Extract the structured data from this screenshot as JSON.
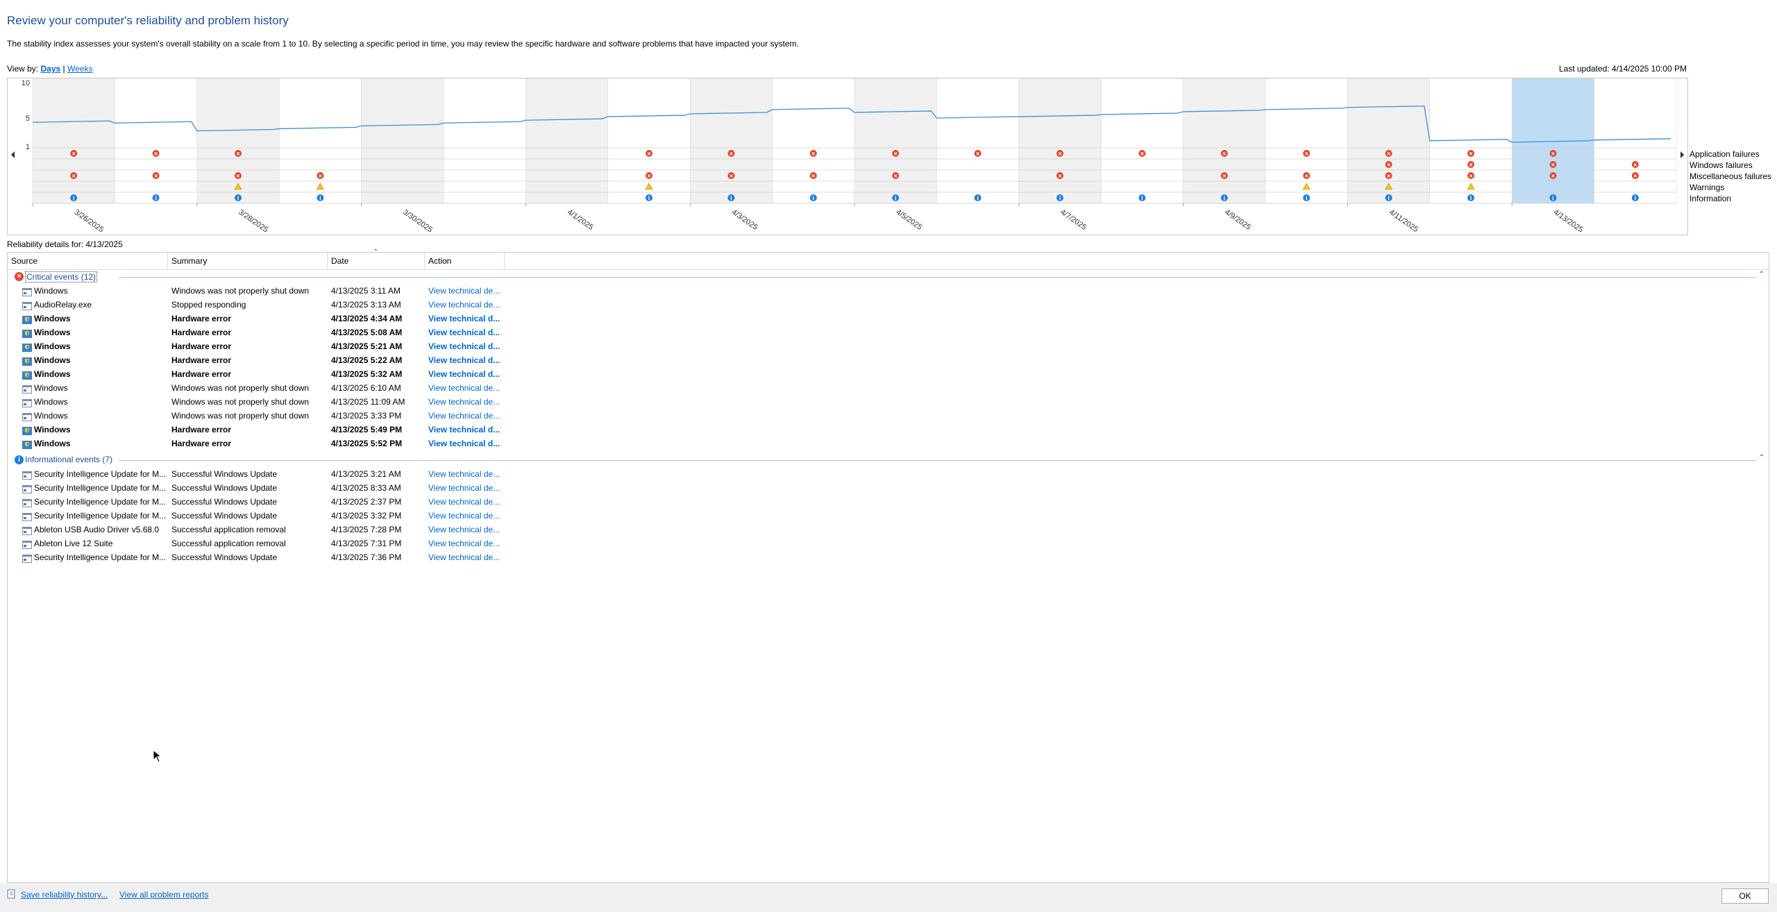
{
  "header": {
    "title": "Review your computer's reliability and problem history",
    "description": "The stability index assesses your system's overall stability on a scale from 1 to 10. By selecting a specific period in time, you may review the specific hardware and software problems that have impacted your system.",
    "view_by_label": "View by:",
    "view_days": "Days",
    "view_sep": "|",
    "view_weeks": "Weeks",
    "last_updated": "Last updated: 4/14/2025 10:00 PM"
  },
  "chart_data": {
    "type": "line",
    "y_ticks": [
      "10",
      "5",
      "1"
    ],
    "ylim": [
      1,
      10
    ],
    "x_labels": [
      "3/26/2025",
      "3/28/2025",
      "3/30/2025",
      "4/1/2025",
      "4/3/2025",
      "4/5/2025",
      "4/7/2025",
      "4/9/2025",
      "4/11/2025",
      "4/13/2025"
    ],
    "selected_day_index": 18,
    "stability_index": [
      3.4,
      3.3,
      2.2,
      2.5,
      2.9,
      3.3,
      3.7,
      4.2,
      4.6,
      5.2,
      4.8,
      4.0,
      4.2,
      4.5,
      4.9,
      5.2,
      5.5,
      0.8,
      0.6,
      0.9
    ],
    "rows": [
      "Application failures",
      "Windows failures",
      "Miscellaneous failures",
      "Warnings",
      "Information"
    ],
    "markers": {
      "Application failures": [
        0,
        1,
        2,
        7,
        8,
        9,
        10,
        11,
        12,
        13,
        14,
        15,
        16,
        17,
        18
      ],
      "Windows failures": [
        16,
        17,
        18,
        19
      ],
      "Miscellaneous failures": [
        0,
        1,
        2,
        3,
        7,
        8,
        9,
        10,
        12,
        14,
        15,
        16,
        17,
        18,
        19
      ],
      "Warnings": [
        2,
        3,
        7,
        15,
        16,
        17
      ],
      "Information": [
        0,
        1,
        2,
        3,
        7,
        8,
        9,
        10,
        11,
        12,
        13,
        14,
        15,
        16,
        17,
        18,
        19
      ]
    }
  },
  "legend": {
    "app_failures": "Application failures",
    "win_failures": "Windows failures",
    "misc_failures": "Miscellaneous failures",
    "warnings": "Warnings",
    "information": "Information"
  },
  "details": {
    "label": "Reliability details for: 4/13/2025",
    "columns": {
      "source": "Source",
      "summary": "Summary",
      "date": "Date",
      "action": "Action"
    },
    "critical_group": "Critical events (12)",
    "info_group": "Informational events (7)",
    "critical_rows": [
      {
        "source": "Windows",
        "summary": "Windows was not properly shut down",
        "date": "4/13/2025 3:11 AM",
        "action": "View technical de...",
        "bold": false
      },
      {
        "source": "AudioRelay.exe",
        "summary": "Stopped responding",
        "date": "4/13/2025 3:13 AM",
        "action": "View technical de...",
        "bold": false
      },
      {
        "source": "Windows",
        "summary": "Hardware error",
        "date": "4/13/2025 4:34 AM",
        "action": "View technical d...",
        "bold": true
      },
      {
        "source": "Windows",
        "summary": "Hardware error",
        "date": "4/13/2025 5:08 AM",
        "action": "View technical d...",
        "bold": true
      },
      {
        "source": "Windows",
        "summary": "Hardware error",
        "date": "4/13/2025 5:21 AM",
        "action": "View technical d...",
        "bold": true
      },
      {
        "source": "Windows",
        "summary": "Hardware error",
        "date": "4/13/2025 5:22 AM",
        "action": "View technical d...",
        "bold": true
      },
      {
        "source": "Windows",
        "summary": "Hardware error",
        "date": "4/13/2025 5:32 AM",
        "action": "View technical d...",
        "bold": true
      },
      {
        "source": "Windows",
        "summary": "Windows was not properly shut down",
        "date": "4/13/2025 6:10 AM",
        "action": "View technical de...",
        "bold": false
      },
      {
        "source": "Windows",
        "summary": "Windows was not properly shut down",
        "date": "4/13/2025 11:09 AM",
        "action": "View technical de...",
        "bold": false
      },
      {
        "source": "Windows",
        "summary": "Windows was not properly shut down",
        "date": "4/13/2025 3:33 PM",
        "action": "View technical de...",
        "bold": false
      },
      {
        "source": "Windows",
        "summary": "Hardware error",
        "date": "4/13/2025 5:49 PM",
        "action": "View technical d...",
        "bold": true
      },
      {
        "source": "Windows",
        "summary": "Hardware error",
        "date": "4/13/2025 5:52 PM",
        "action": "View technical d...",
        "bold": true
      }
    ],
    "info_rows": [
      {
        "source": "Security Intelligence Update for M...",
        "summary": "Successful Windows Update",
        "date": "4/13/2025 3:21 AM",
        "action": "View technical de..."
      },
      {
        "source": "Security Intelligence Update for M...",
        "summary": "Successful Windows Update",
        "date": "4/13/2025 8:33 AM",
        "action": "View technical de..."
      },
      {
        "source": "Security Intelligence Update for M...",
        "summary": "Successful Windows Update",
        "date": "4/13/2025 2:37 PM",
        "action": "View technical de..."
      },
      {
        "source": "Security Intelligence Update for M...",
        "summary": "Successful Windows Update",
        "date": "4/13/2025 3:32 PM",
        "action": "View technical de..."
      },
      {
        "source": "Ableton USB Audio Driver v5.68.0",
        "summary": "Successful application removal",
        "date": "4/13/2025 7:28 PM",
        "action": "View technical de..."
      },
      {
        "source": "Ableton Live 12 Suite",
        "summary": "Successful application removal",
        "date": "4/13/2025 7:31 PM",
        "action": "View technical de..."
      },
      {
        "source": "Security Intelligence Update for M...",
        "summary": "Successful Windows Update",
        "date": "4/13/2025 7:36 PM",
        "action": "View technical de..."
      }
    ]
  },
  "footer": {
    "save_history": "Save reliability history...",
    "view_reports": "View all problem reports",
    "ok": "OK"
  },
  "colors": {
    "error": "#e0482f",
    "info": "#1f7fd8",
    "warning": "#f3c521",
    "selected": "#bfdcf4",
    "line": "#3b8fd8",
    "shade": "#f0f0f0"
  }
}
